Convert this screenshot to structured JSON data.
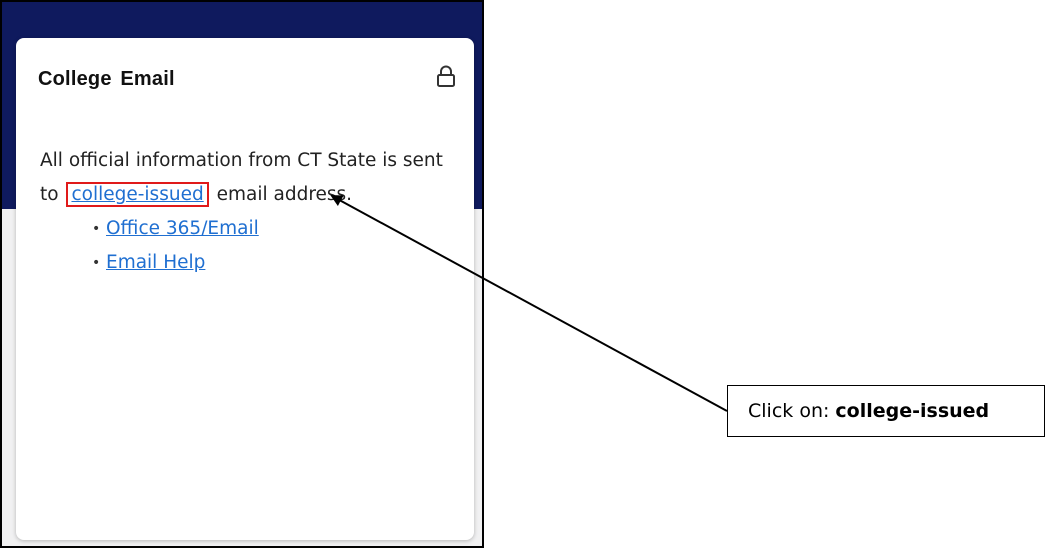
{
  "card": {
    "title": "College Email",
    "lock_icon": "lock-icon",
    "text_before": "All official information from CT State is sent to",
    "highlighted_link": "college-issued",
    "text_after": "email address.",
    "links": [
      "Office 365/Email",
      "Email Help"
    ]
  },
  "annotation": {
    "prefix": "Click on:",
    "target": "college-issued"
  },
  "colors": {
    "header_band": "#0f1a5e",
    "link": "#1f6fd1",
    "highlight_box": "#e01a1a"
  }
}
